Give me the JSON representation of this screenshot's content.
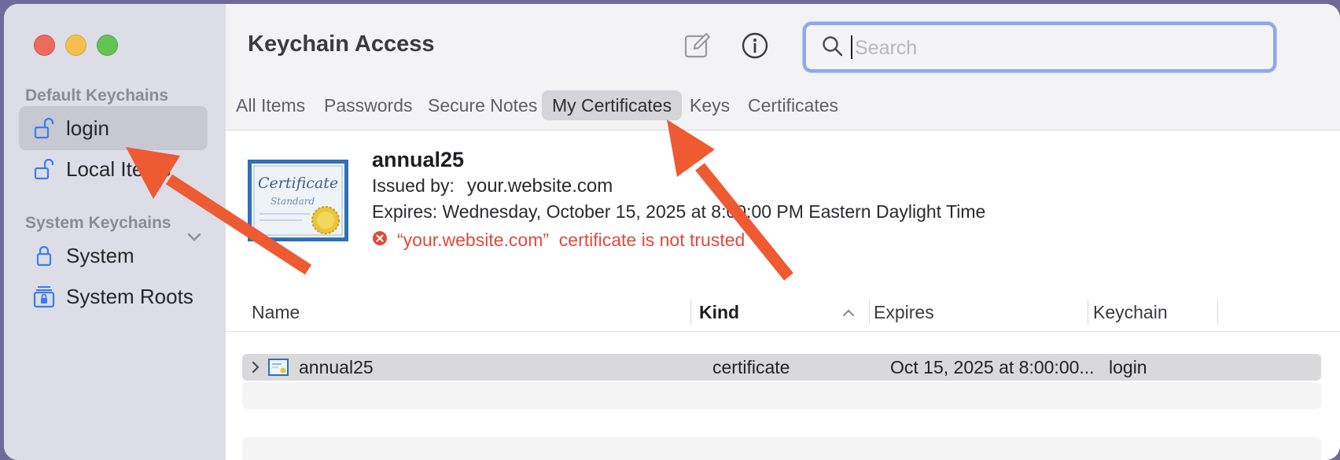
{
  "app": {
    "title": "Keychain Access"
  },
  "sidebar": {
    "default_header": "Default Keychains",
    "system_header": "System Keychains",
    "items": [
      {
        "label": "login",
        "icon": "unlocked-padlock-icon",
        "selected": true
      },
      {
        "label": "Local Items",
        "icon": "unlocked-padlock-icon",
        "selected": false
      },
      {
        "label": "System",
        "icon": "padlock-icon",
        "selected": false
      },
      {
        "label": "System Roots",
        "icon": "cabinet-lock-icon",
        "selected": false
      }
    ]
  },
  "toolbar": {
    "edit_icon": "compose-icon",
    "info_icon": "info-icon",
    "search_placeholder": "Search",
    "search_value": ""
  },
  "tabs": [
    {
      "label": "All Items",
      "active": false
    },
    {
      "label": "Passwords",
      "active": false
    },
    {
      "label": "Secure Notes",
      "active": false
    },
    {
      "label": "My Certificates",
      "active": true
    },
    {
      "label": "Keys",
      "active": false
    },
    {
      "label": "Certificates",
      "active": false
    }
  ],
  "detail": {
    "name": "annual25",
    "issued_by_label": "Issued by:",
    "issued_by_value": "your.website.com",
    "expires": "Expires: Wednesday, October 15, 2025 at 8:00:00 PM Eastern Daylight Time",
    "warning_name": "“your.website.com”",
    "warning_text": "certificate is not trusted",
    "cert_image_lines": [
      "Certificate",
      "Standard"
    ]
  },
  "table": {
    "columns": [
      "Name",
      "Kind",
      "Expires",
      "Keychain"
    ],
    "sorted_column": "Kind",
    "rows": [
      {
        "name": "annual25",
        "kind": "certificate",
        "expires": "Oct 15, 2025 at 8:00:00...",
        "keychain": "login"
      }
    ]
  },
  "colors": {
    "annotation_arrow": "#ee5a32",
    "warning": "#e04a3b",
    "accent": "#3b82f6"
  }
}
